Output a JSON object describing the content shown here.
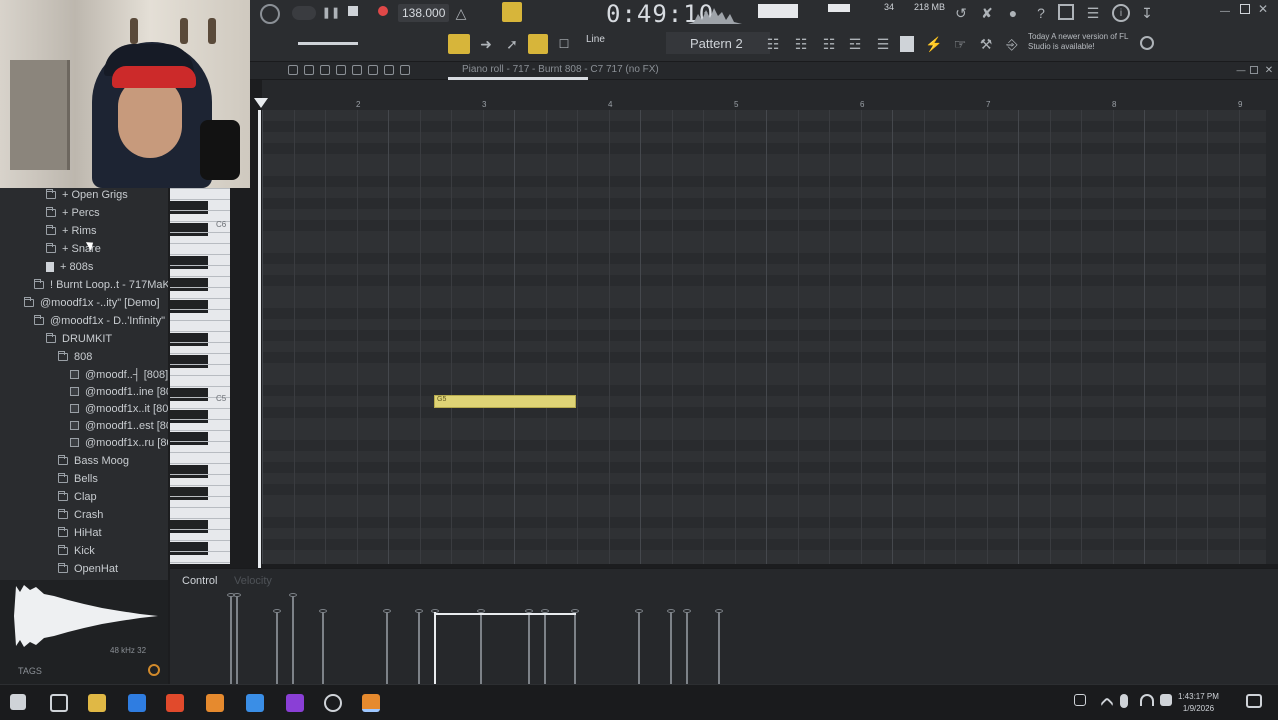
{
  "toolbar": {
    "bpm": "138.000",
    "time": "0:49:10",
    "pattern": "Pattern 2",
    "snap": "Line",
    "memory": "218 MB",
    "cpu": "34",
    "update_notice": "Today  A newer version of FL Studio is available!"
  },
  "piano_roll": {
    "title": "Piano roll - 717 - Burnt 808 - C7 717 (no FX)",
    "bars": [
      "2",
      "3",
      "4",
      "5",
      "6",
      "7",
      "8",
      "9"
    ],
    "octave_labels": [
      "C6",
      "C5"
    ],
    "note_label": "G5"
  },
  "browser": {
    "items": [
      {
        "label": "+ Open Grigs",
        "kind": "folder"
      },
      {
        "label": "+ Percs",
        "kind": "folder"
      },
      {
        "label": "+ Rims",
        "kind": "folder"
      },
      {
        "label": "+ Snare",
        "kind": "folder"
      },
      {
        "label": "+ 808s",
        "kind": "file"
      },
      {
        "label": "! Burnt Loop..t - 717MaKid",
        "kind": "folder"
      },
      {
        "label": "@moodf1x -..ity\" [Demo]",
        "kind": "folder"
      },
      {
        "label": "@moodf1x - D..'Infinity\"",
        "kind": "folder"
      },
      {
        "label": "DRUMKIT",
        "kind": "folder"
      },
      {
        "label": "808",
        "kind": "folder"
      },
      {
        "label": "@moodf..┤  [808]",
        "kind": "sample"
      },
      {
        "label": "@moodf1..ine [808]",
        "kind": "sample"
      },
      {
        "label": "@moodf1x..it [808]",
        "kind": "sample"
      },
      {
        "label": "@moodf1..est [808]",
        "kind": "sample"
      },
      {
        "label": "@moodf1x..ru [808]",
        "kind": "sample"
      },
      {
        "label": "Bass Moog",
        "kind": "folder"
      },
      {
        "label": "Bells",
        "kind": "folder"
      },
      {
        "label": "Clap",
        "kind": "folder"
      },
      {
        "label": "Crash",
        "kind": "folder"
      },
      {
        "label": "HiHat",
        "kind": "folder"
      },
      {
        "label": "Kick",
        "kind": "folder"
      },
      {
        "label": "OpenHat",
        "kind": "folder"
      }
    ],
    "preview_info": "48 kHz 32",
    "tags_label": "TAGS"
  },
  "event_editor": {
    "control_label": "Control",
    "velocity_label": "Velocity"
  },
  "taskbar": {
    "time": "1:43:17 PM",
    "date": "1/9/2026"
  },
  "colors": {
    "note": "#dfd476",
    "accent": "#d7b53a"
  }
}
